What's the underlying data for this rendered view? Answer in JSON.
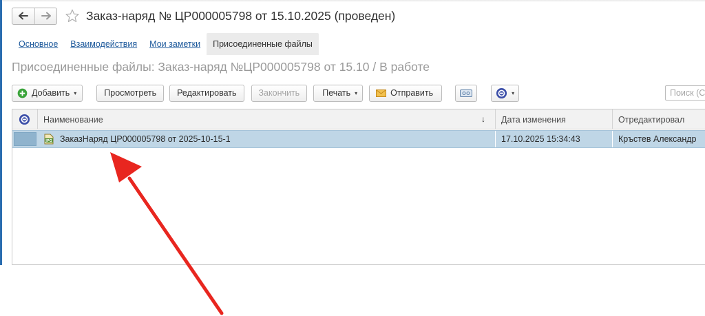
{
  "window": {
    "title": "Заказ-наряд № ЦР000005798 от 15.10.2025 (проведен)",
    "nav": {
      "back_icon": "arrow-left-icon",
      "forward_icon": "arrow-right-icon",
      "favorite_icon": "star-icon"
    }
  },
  "tabs": [
    {
      "label": "Основное",
      "active": false
    },
    {
      "label": "Взаимодействия",
      "active": false
    },
    {
      "label": "Мои заметки",
      "active": false
    },
    {
      "label": "Присоединенные файлы",
      "active": true
    }
  ],
  "subtitle": "Присоединенные файлы: Заказ-наряд №ЦР000005798 от 15.10 / В работе",
  "toolbar": {
    "add_label": "Добавить",
    "view_label": "Просмотреть",
    "edit_label": "Редактировать",
    "finish_label": "Закончить",
    "print_label": "Печать",
    "send_label": "Отправить",
    "search_placeholder": "Поиск (Ctrl+F)"
  },
  "table": {
    "columns": [
      "Наименование",
      "Дата изменения",
      "Отредактировал"
    ],
    "sort_indicator": "↓",
    "rows": [
      {
        "name": "ЗаказНаряд ЦР000005798 от 2025-10-15-1",
        "file_icon": "jpg-file-icon",
        "modified": "17.10.2025 15:34:43",
        "editor": "Кръстев Александр"
      }
    ]
  },
  "colors": {
    "selection": "#bfd6e6",
    "link": "#1e5a9c",
    "add_icon": "#3aa33a",
    "annotation_arrow": "#e8261f",
    "accent": "#2a6db0"
  }
}
